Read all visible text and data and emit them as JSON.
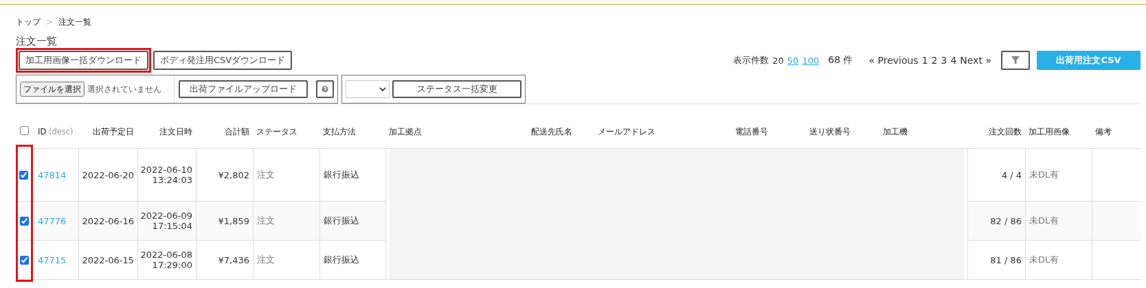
{
  "breadcrumb": {
    "items": [
      "トップ",
      "注文一覧"
    ],
    "separator": ">"
  },
  "title": "注文一覧",
  "actions": [
    {
      "label": "加工用画像一括ダウンロード",
      "highlighted": true
    },
    {
      "label": "ボディ発注用CSVダウンロード",
      "highlighted": false
    }
  ],
  "pager": {
    "per_page_label": "表示件数",
    "per_page_options": [
      {
        "label": "20",
        "selected": true
      },
      {
        "label": "50",
        "selected": false
      },
      {
        "label": "100",
        "selected": false
      }
    ],
    "total": "68 件",
    "previous": "« Previous",
    "pages": [
      "1",
      "2",
      "3",
      "4"
    ],
    "next": "Next »"
  },
  "export_button": "出荷用注文CSV",
  "upload": {
    "file_button": "ファイルを選択",
    "file_status": "選択されていません",
    "upload_button": "出荷ファイルアップロード"
  },
  "bulk_status": {
    "button": "ステータス一括変更"
  },
  "table": {
    "select_all_checked": false,
    "checkbox_column_highlighted": true,
    "columns": [
      {
        "label": "ID",
        "sort_hint": "(desc)"
      },
      {
        "label": "出荷予定日"
      },
      {
        "label": "注文日時"
      },
      {
        "label": "合計額"
      },
      {
        "label": "ステータス"
      },
      {
        "label": "支払方法"
      },
      {
        "label": "加工拠点"
      },
      {
        "label": "配送先氏名"
      },
      {
        "label": "メールアドレス"
      },
      {
        "label": "電話番号"
      },
      {
        "label": "送り状番号"
      },
      {
        "label": "加工機"
      },
      {
        "label": "注文回数"
      },
      {
        "label": "加工用画像"
      },
      {
        "label": "備考"
      }
    ],
    "rows": [
      {
        "checked": true,
        "id": "47814",
        "ship_date": "2022-06-20",
        "order_date": "2022-06-10",
        "order_time": "13:24:03",
        "total": "¥2,802",
        "status": "注文",
        "payment": "銀行振込",
        "order_count": "4 / 4",
        "image_status": "未DL有"
      },
      {
        "checked": true,
        "id": "47776",
        "ship_date": "2022-06-16",
        "order_date": "2022-06-09",
        "order_time": "17:15:04",
        "total": "¥1,859",
        "status": "注文",
        "payment": "銀行振込",
        "order_count": "82 / 86",
        "image_status": "未DL有"
      },
      {
        "checked": true,
        "id": "47715",
        "ship_date": "2022-06-15",
        "order_date": "2022-06-08",
        "order_time": "17:29:00",
        "total": "¥7,436",
        "status": "注文",
        "payment": "銀行振込",
        "order_count": "81 / 86",
        "image_status": "未DL有"
      }
    ]
  }
}
